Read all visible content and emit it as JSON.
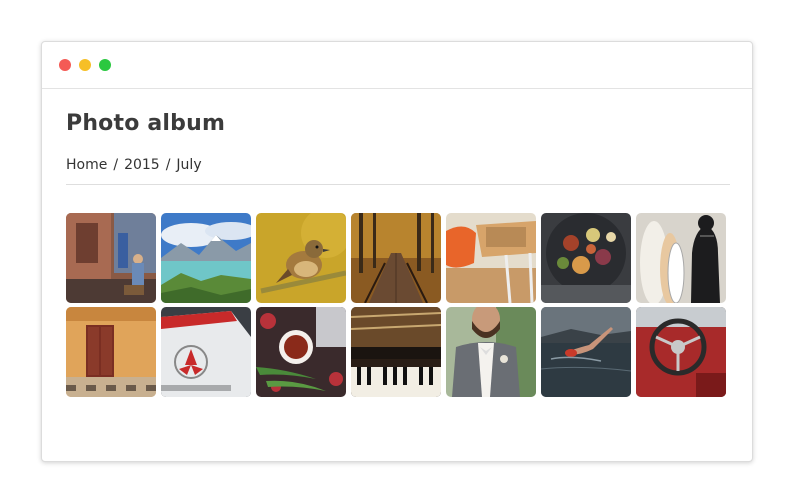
{
  "window": {
    "controls": [
      "close",
      "minimize",
      "maximize"
    ]
  },
  "page": {
    "title": "Photo album",
    "breadcrumb": [
      {
        "label": "Home"
      },
      {
        "label": "2015"
      },
      {
        "label": "July"
      }
    ],
    "separator": "/"
  },
  "photos": [
    {
      "subject": "woman-in-alley"
    },
    {
      "subject": "mountain-lake"
    },
    {
      "subject": "small-bird"
    },
    {
      "subject": "forest-boardwalk"
    },
    {
      "subject": "orange-chair-desk"
    },
    {
      "subject": "food-platter"
    },
    {
      "subject": "surfer-with-boards"
    },
    {
      "subject": "orange-building-door"
    },
    {
      "subject": "vintage-car-tail"
    },
    {
      "subject": "tea-and-flowers"
    },
    {
      "subject": "piano-keys"
    },
    {
      "subject": "man-in-suit"
    },
    {
      "subject": "swimmer-in-lake"
    },
    {
      "subject": "red-car-steering-wheel"
    }
  ]
}
